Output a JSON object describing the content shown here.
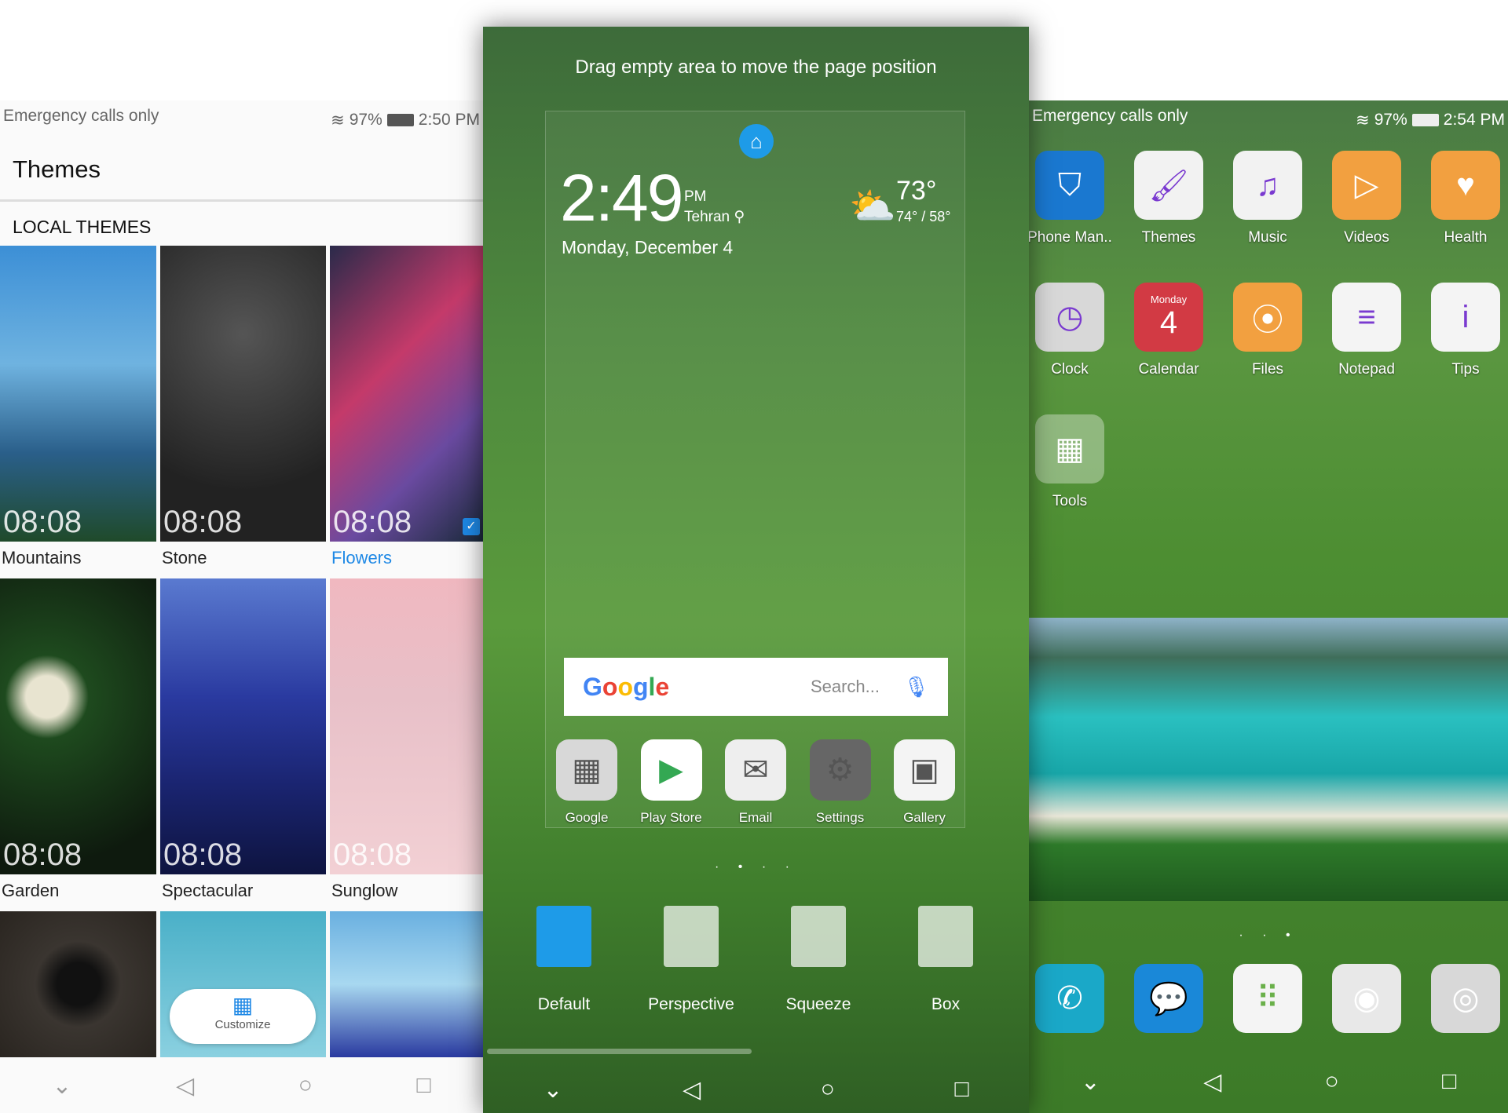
{
  "left": {
    "status": {
      "carrier": "Emergency calls only",
      "battery": "97%",
      "time": "2:50 PM"
    },
    "title": "Themes",
    "section": "LOCAL THEMES",
    "themes": [
      {
        "name": "Mountains",
        "time": "08:08",
        "bg": "linear-gradient(180deg,#3c8fd6,#6fb3e0 40%,#2a5f8a 70%,#1f4a2a)",
        "selected": false
      },
      {
        "name": "Stone",
        "time": "08:08",
        "bg": "radial-gradient(circle at 50% 30%,#555,#222 70%)",
        "selected": false
      },
      {
        "name": "Flowers",
        "time": "08:08",
        "bg": "linear-gradient(135deg,#2a2a4a,#c43a6a 40%,#6a4aa0 70%,#1a2a3a)",
        "selected": true
      },
      {
        "name": "Garden",
        "time": "08:08",
        "bg": "radial-gradient(circle at 30% 40%,#e8e4d0 0 10%,#1e4a1e 20%,#0e1a0e 80%)",
        "selected": false
      },
      {
        "name": "Spectacular",
        "time": "08:08",
        "bg": "linear-gradient(180deg,#5a7ad0,#2a3aa0 40%,#1a2470 70%,#0e1440)",
        "selected": false
      },
      {
        "name": "Sunglow",
        "time": "08:08",
        "bg": "linear-gradient(180deg,#f0b8c0,#e8c0c8 40%,#f2d0d4)",
        "selected": false
      },
      {
        "name": "",
        "time": "",
        "bg": "radial-gradient(circle,#111 0 20%,#3a3530 40%,#2a2520)",
        "selected": false
      },
      {
        "name": "",
        "time": "",
        "bg": "linear-gradient(180deg,#4ab0c8,#8ad0e0)",
        "selected": false
      },
      {
        "name": "",
        "time": "",
        "bg": "linear-gradient(180deg,#6ab0e0,#a8d8f0 50%,#2a3aa0)",
        "selected": false
      }
    ],
    "customize": "Customize",
    "accent": "#1e88e5"
  },
  "middle": {
    "hint": "Drag empty area to move the page position",
    "clock": {
      "time": "2:49",
      "ampm": "PM",
      "city": "Tehran",
      "date": "Monday, December 4"
    },
    "weather": {
      "temp": "73°",
      "range": "74° / 58°",
      "icon": "partly-cloudy-icon"
    },
    "search": {
      "logo": "Google",
      "placeholder": "Search..."
    },
    "dock": [
      {
        "label": "Google",
        "color": "#d8d8d8",
        "glyph": "▦"
      },
      {
        "label": "Play Store",
        "color": "#ffffff",
        "glyph": "▶"
      },
      {
        "label": "Email",
        "color": "#eeeeee",
        "glyph": "✉"
      },
      {
        "label": "Settings",
        "color": "#666666",
        "glyph": "⚙"
      },
      {
        "label": "Gallery",
        "color": "#f4f4f4",
        "glyph": "▣"
      }
    ],
    "dots": "· • · ·",
    "effects": [
      "Default",
      "Perspective",
      "Squeeze",
      "Box"
    ],
    "effect_selected": "Default"
  },
  "right": {
    "status": {
      "carrier": "Emergency calls only",
      "battery": "97%",
      "time": "2:54 PM"
    },
    "apps": [
      {
        "label": "Phone Man..",
        "color": "#1a78d0",
        "glyph": "⛉"
      },
      {
        "label": "Themes",
        "color": "#f2f2f2",
        "glyph": "🖌"
      },
      {
        "label": "Music",
        "color": "#f2f2f2",
        "glyph": "♫"
      },
      {
        "label": "Videos",
        "color": "#f2a040",
        "glyph": "▷"
      },
      {
        "label": "Health",
        "color": "#f2a040",
        "glyph": "♥"
      },
      {
        "label": "Clock",
        "color": "#d8d8d8",
        "glyph": "◷"
      },
      {
        "label": "Calendar",
        "color": "#d23a44",
        "glyph": "4",
        "sub": "Monday"
      },
      {
        "label": "Files",
        "color": "#f2a040",
        "glyph": "⦿"
      },
      {
        "label": "Notepad",
        "color": "#f4f4f4",
        "glyph": "≡"
      },
      {
        "label": "Tips",
        "color": "#f4f4f4",
        "glyph": "i"
      },
      {
        "label": "Tools",
        "color": "rgba(255,255,255,0.35)",
        "glyph": "▦"
      }
    ],
    "dots": "· · •",
    "dock": [
      {
        "name": "phone",
        "color": "#1aa8c8",
        "glyph": "✆"
      },
      {
        "name": "messages",
        "color": "#1a88d8",
        "glyph": "💬"
      },
      {
        "name": "app-drawer",
        "color": "#f4f4f4",
        "glyph": "⠿"
      },
      {
        "name": "chrome",
        "color": "#e8e8e8",
        "glyph": "◉"
      },
      {
        "name": "camera",
        "color": "#d8d8d8",
        "glyph": "◎"
      }
    ]
  }
}
